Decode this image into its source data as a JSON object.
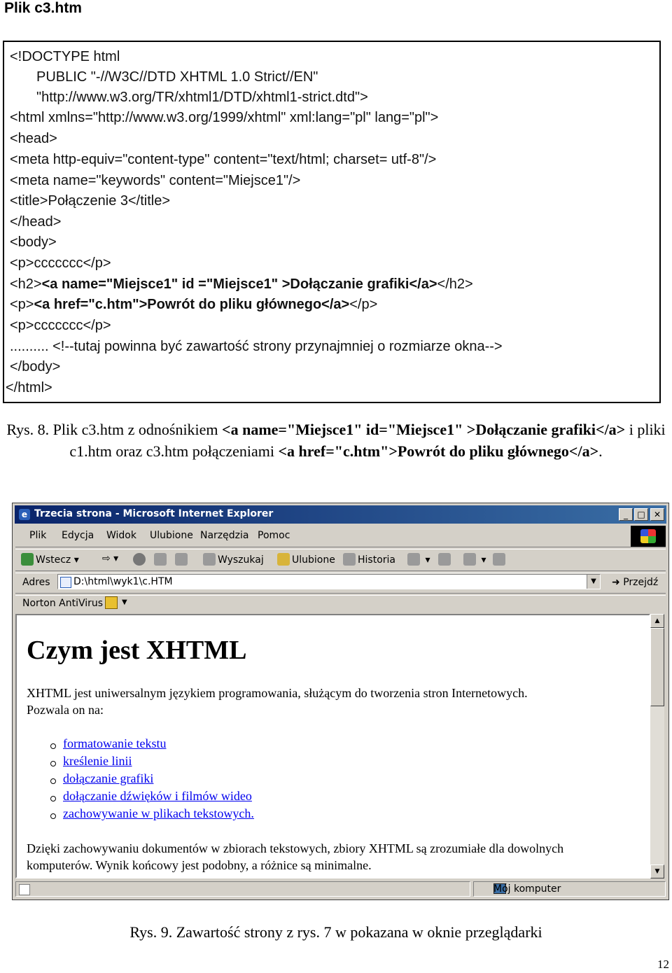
{
  "heading": "Plik c3.htm",
  "code_lines": [
    "<!DOCTYPE html",
    "PUBLIC \"-//W3C//DTD XHTML 1.0 Strict//EN\"",
    "\"http://www.w3.org/TR/xhtml1/DTD/xhtml1-strict.dtd\">",
    "<html xmlns=\"http://www.w3.org/1999/xhtml\" xml:lang=\"pl\" lang=\"pl\">",
    "<head>",
    "<meta http-equiv=\"content-type\" content=\"text/html; charset= utf-8\"/>",
    "<meta name=\"keywords\" content=\"Miejsce1\"/>",
    "<title>Połączenie 3</title>",
    "</head>",
    "<body>",
    "<p>ccccccc</p>",
    "<h2>",
    "<a name=\"Miejsce1\" id =\"Miejsce1\" >Dołączanie grafiki</a>",
    "</h2>",
    "<p>",
    "<a href=\"c.htm\">Powrót do pliku głównego</a>",
    "</p>",
    "<p>ccccccc</p>",
    ".......... <!--tutaj powinna być zawartość strony przynajmniej o rozmiarze okna-->",
    "</body>",
    "</html>"
  ],
  "caption8": {
    "part1": "Rys. 8. Plik c3.htm z odnośnikiem ",
    "part2": "<a name=\"Miejsce1\" id=\"Miejsce1\" >Dołączanie grafiki</a>",
    "part3": " i pliki c1.htm oraz c3.htm połączeniami ",
    "part4": "<a href=\"c.htm\">Powrót do pliku głównego</a>",
    "part5": "."
  },
  "browser": {
    "title": "Trzecia strona - Microsoft Internet Explorer",
    "menu": [
      "Plik",
      "Edycja",
      "Widok",
      "Ulubione",
      "Narzędzia",
      "Pomoc"
    ],
    "toolbar": {
      "back": "Wstecz",
      "search": "Wyszukaj",
      "favorites": "Ulubione",
      "history": "Historia"
    },
    "address_label": "Adres",
    "address_value": "D:\\html\\wyk1\\c.HTM",
    "go_label": "Przejdź",
    "norton_label": "Norton AntiVirus",
    "status_zone": "Mój komputer",
    "page": {
      "heading": "Czym jest XHTML",
      "para1_line1": "XHTML jest uniwersalnym językiem programowania, służącym do tworzenia stron Internetowych.",
      "para1_line2": "Pozwala on na:",
      "links": [
        "formatowanie tekstu",
        "kreślenie linii",
        "dołączanie grafiki",
        "dołączanie dźwięków i filmów wideo",
        "zachowywanie w plikach tekstowych."
      ],
      "para2_line1": "Dzięki zachowywaniu dokumentów w zbiorach tekstowych, zbiory XHTML są zrozumiałe dla dowolnych",
      "para2_line2": "komputerów. Wynik końcowy jest podobny, a różnice są minimalne."
    }
  },
  "caption9": "Rys. 9. Zawartość strony z rys. 7 w pokazana w oknie przeglądarki",
  "page_number": "12"
}
